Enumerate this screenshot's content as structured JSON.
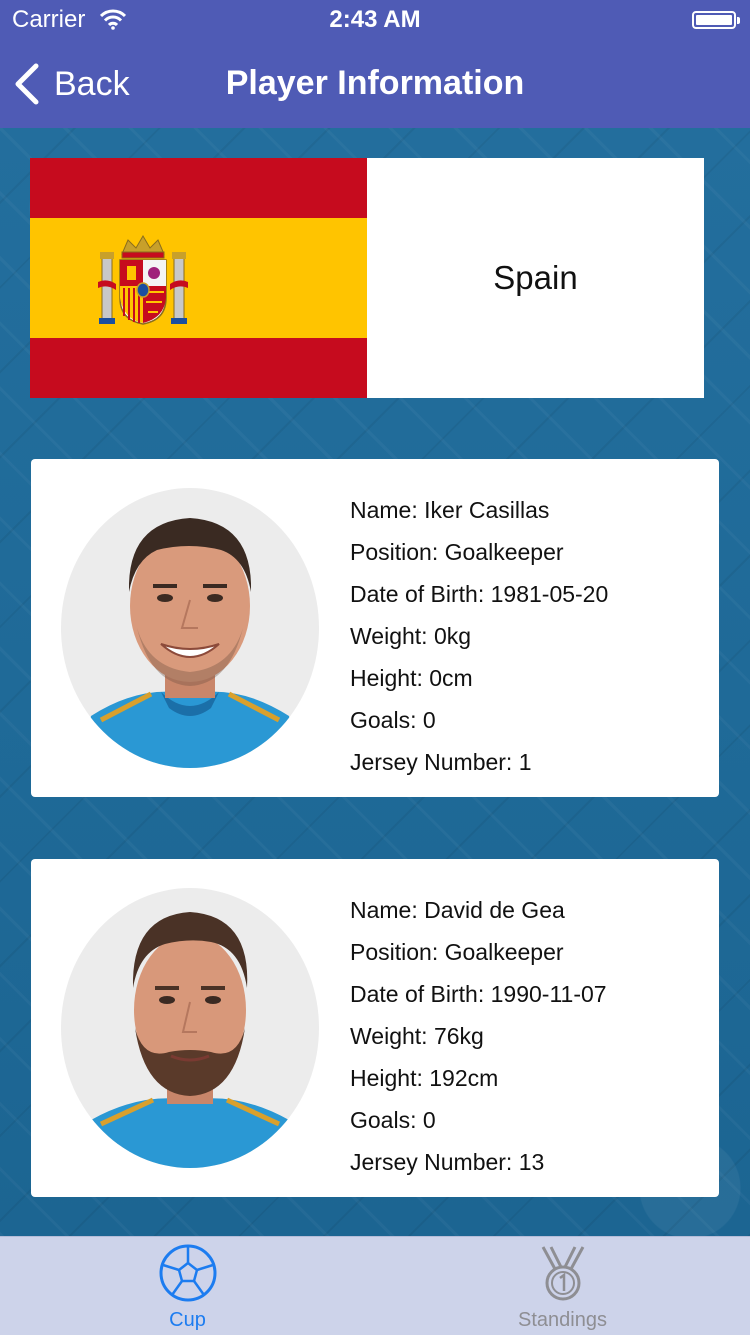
{
  "status_bar": {
    "carrier": "Carrier",
    "time": "2:43 AM"
  },
  "nav": {
    "back_label": "Back",
    "title": "Player Information"
  },
  "team": {
    "name": "Spain",
    "flag_icon": "spain-flag"
  },
  "players": [
    {
      "name": "Name: Iker Casillas",
      "position": "Position: Goalkeeper",
      "dob": "Date of Birth: 1981-05-20",
      "weight": "Weight: 0kg",
      "height": "Height: 0cm",
      "goals": "Goals: 0",
      "jersey": "Jersey Number: 1"
    },
    {
      "name": "Name: David de Gea",
      "position": "Position: Goalkeeper",
      "dob": "Date of Birth: 1990-11-07",
      "weight": "Weight: 76kg",
      "height": "Height: 192cm",
      "goals": "Goals: 0",
      "jersey": "Jersey Number: 13"
    }
  ],
  "tabs": [
    {
      "label": "Cup",
      "icon": "soccer-ball-icon",
      "selected": true
    },
    {
      "label": "Standings",
      "icon": "medal-icon",
      "selected": false
    }
  ],
  "colors": {
    "nav_bg": "#4f5bb5",
    "tab_selected": "#1c7cf0",
    "tab_unselected": "#8e8e93",
    "flag_red": "#c60b1e",
    "flag_yellow": "#ffc400"
  }
}
